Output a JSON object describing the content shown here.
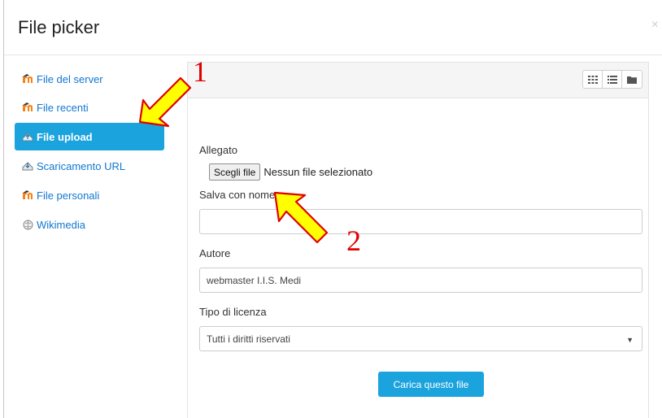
{
  "dialog": {
    "title": "File picker",
    "close": "×"
  },
  "sidebar": {
    "items": [
      {
        "label": "File del server",
        "icon": "moodle-icon",
        "active": false
      },
      {
        "label": "File recenti",
        "icon": "moodle-icon",
        "active": false
      },
      {
        "label": "File upload",
        "icon": "upload-icon",
        "active": true
      },
      {
        "label": "Scaricamento URL",
        "icon": "download-url-icon",
        "active": false
      },
      {
        "label": "File personali",
        "icon": "moodle-icon",
        "active": false
      },
      {
        "label": "Wikimedia",
        "icon": "wikimedia-icon",
        "active": false
      }
    ]
  },
  "toolbar": {
    "views": [
      "grid-view-icon",
      "list-view-icon",
      "folder-view-icon"
    ]
  },
  "form": {
    "attachment_label": "Allegato",
    "choose_button": "Scegli file",
    "no_file": "Nessun file selezionato",
    "saveas_label": "Salva con nome",
    "saveas_value": "",
    "author_label": "Autore",
    "author_value": "webmaster I.I.S. Medi",
    "license_label": "Tipo di licenza",
    "license_value": "Tutti i diritti riservati",
    "upload_button": "Carica questo file"
  },
  "annotations": {
    "step1": "1",
    "step2": "2",
    "arrow_color": "#ffff00",
    "number_color": "#e00000"
  },
  "colors": {
    "accent": "#1ba3de",
    "link": "#1177d1"
  }
}
